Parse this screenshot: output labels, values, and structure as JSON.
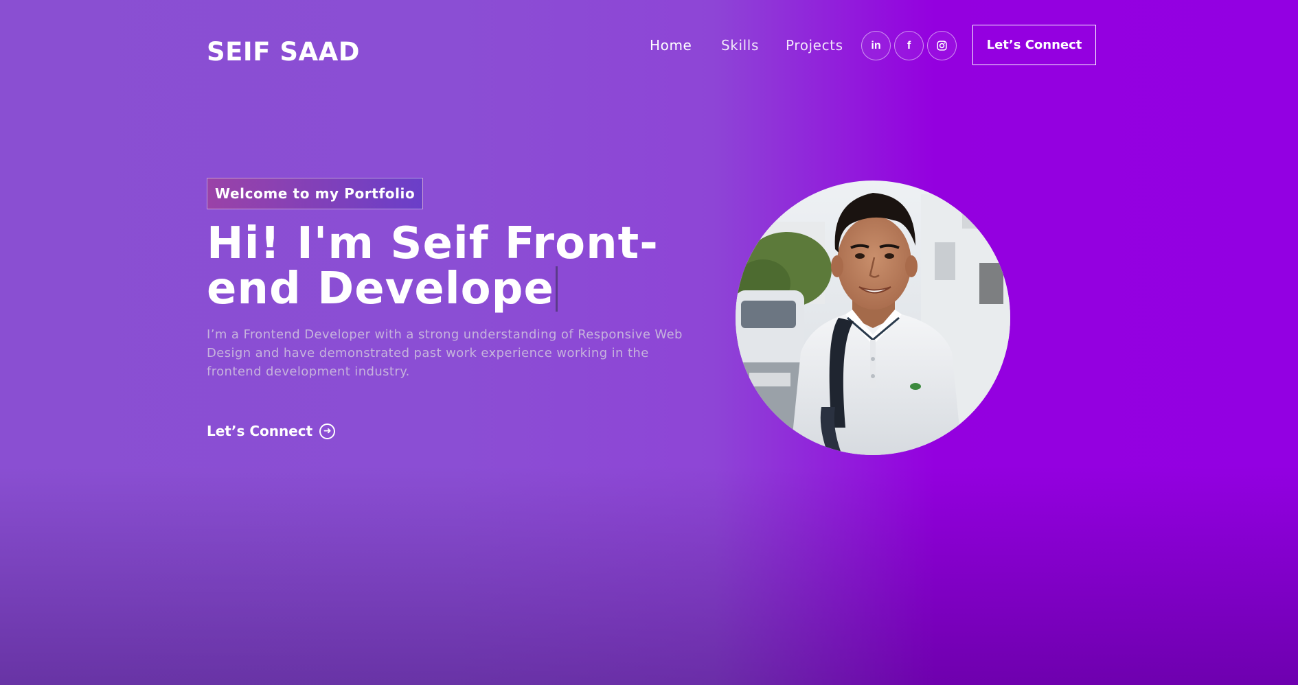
{
  "navbar": {
    "logo": "SEIF SAAD",
    "links": [
      {
        "label": "Home",
        "active": true
      },
      {
        "label": "Skills",
        "active": false
      },
      {
        "label": "Projects",
        "active": false
      }
    ],
    "social": [
      {
        "icon": "linkedin-icon",
        "glyph": "in"
      },
      {
        "icon": "facebook-icon",
        "glyph": "f"
      },
      {
        "icon": "instagram-icon",
        "glyph": ""
      }
    ],
    "connect_label": "Let’s Connect"
  },
  "hero": {
    "tagline": "Welcome to my Portfolio",
    "headline": "Hi! I'm Seif Front-end Develope",
    "intro": "I’m a Frontend Developer with a strong understanding of Responsive Web Design and have demonstrated past work experience working in the frontend development industry.",
    "cta_label": "Let’s Connect",
    "cta_icon": "arrow-right-circle-icon",
    "portrait": "profile-photo"
  },
  "colors": {
    "background_start": "#8a4fd2",
    "background_end": "#9300e2",
    "text": "#ffffff",
    "muted_text": "#c6b3dd"
  }
}
